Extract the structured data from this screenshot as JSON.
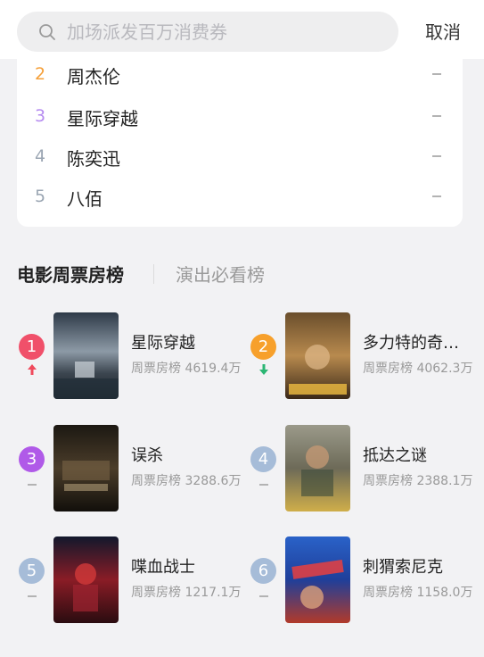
{
  "search": {
    "placeholder": "加场派发百万消费券",
    "cancel_label": "取消"
  },
  "hot_list": [
    {
      "rank": "2",
      "name": "周杰伦",
      "color": "#f5a03a"
    },
    {
      "rank": "3",
      "name": "星际穿越",
      "color": "#b68cf0"
    },
    {
      "rank": "4",
      "name": "陈奕迅",
      "color": "#9ba6b3"
    },
    {
      "rank": "5",
      "name": "八佰",
      "color": "#9ba6b3"
    }
  ],
  "tabs": {
    "active": "电影周票房榜",
    "inactive": "演出必看榜"
  },
  "movies": [
    {
      "rank": "1",
      "title": "星际穿越",
      "label": "周票房榜",
      "value": "4619.4万",
      "badge_color": "#f0506a",
      "trend": "up"
    },
    {
      "rank": "2",
      "title": "多力特的奇幻冒险",
      "label": "周票房榜",
      "value": "4062.3万",
      "badge_color": "#f7a02b",
      "trend": "down"
    },
    {
      "rank": "3",
      "title": "误杀",
      "label": "周票房榜",
      "value": "3288.6万",
      "badge_color": "#b05ae8",
      "trend": "flat"
    },
    {
      "rank": "4",
      "title": "抵达之谜",
      "label": "周票房榜",
      "value": "2388.1万",
      "badge_color": "#a6bcd8",
      "trend": "flat"
    },
    {
      "rank": "5",
      "title": "喋血战士",
      "label": "周票房榜",
      "value": "1217.1万",
      "badge_color": "#a6bcd8",
      "trend": "flat"
    },
    {
      "rank": "6",
      "title": "刺猬索尼克",
      "label": "周票房榜",
      "value": "1158.0万",
      "badge_color": "#a6bcd8",
      "trend": "flat"
    }
  ]
}
